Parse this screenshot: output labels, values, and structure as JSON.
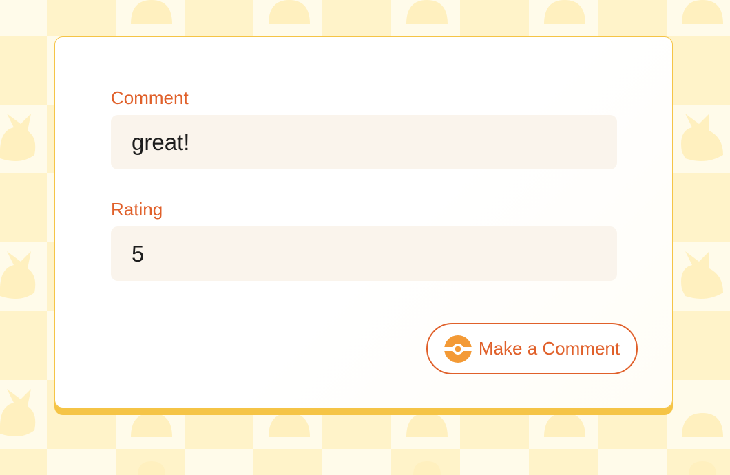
{
  "form": {
    "comment": {
      "label": "Comment",
      "value": "great!"
    },
    "rating": {
      "label": "Rating",
      "value": "5"
    },
    "submit": {
      "label": "Make a Comment",
      "icon": "pokeball-icon"
    }
  },
  "colors": {
    "accent": "#e0602a",
    "card_border": "#f5c446",
    "input_bg": "#faf4ec",
    "background_light": "#fffbea",
    "background_tile": "#fff3c9",
    "pokeball_icon": "#f39a36"
  }
}
